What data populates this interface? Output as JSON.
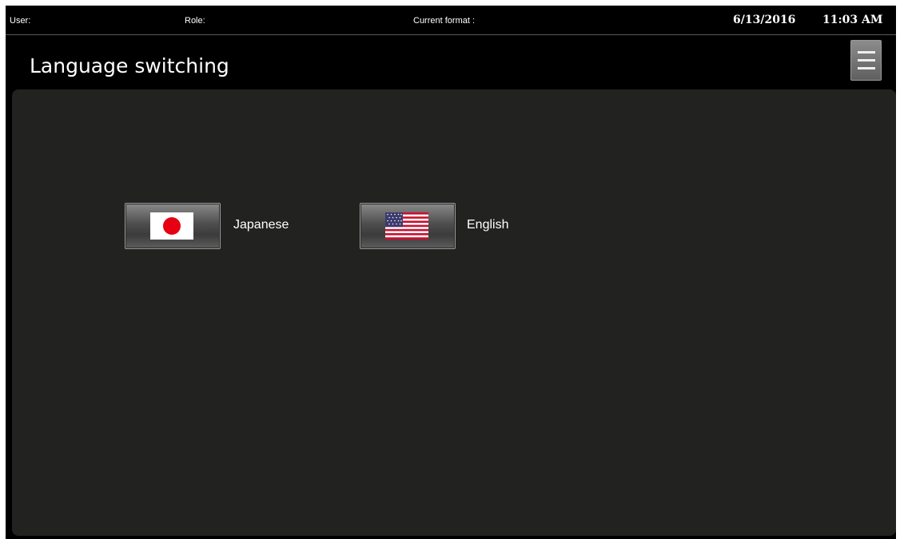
{
  "status_bar": {
    "user_label": "User:",
    "role_label": "Role:",
    "format_label": "Current format :",
    "date": "6/13/2016",
    "time": "11:03 AM"
  },
  "header": {
    "title": "Language switching",
    "menu_icon": "hamburger-menu-icon"
  },
  "languages": [
    {
      "label": "Japanese",
      "icon": "japan-flag-icon"
    },
    {
      "label": "English",
      "icon": "us-flag-icon"
    }
  ],
  "colors": {
    "background": "#000000",
    "panel": "#222321",
    "text": "#ffffff",
    "japan_red": "#e60012",
    "us_red": "#c8102e",
    "us_blue": "#3c3b6e"
  }
}
